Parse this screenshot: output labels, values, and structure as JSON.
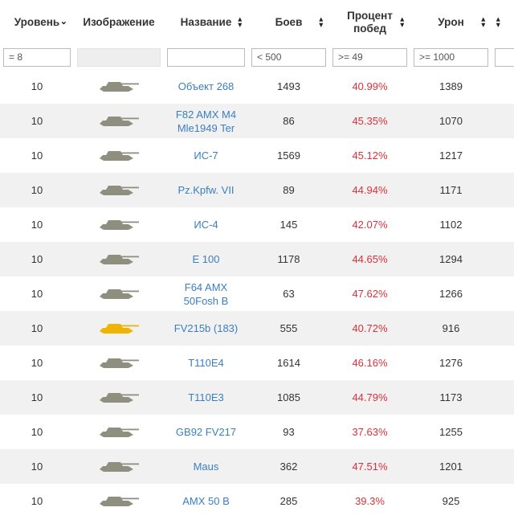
{
  "columns": [
    {
      "key": "level",
      "label": "Уровень",
      "sort": "desc"
    },
    {
      "key": "image",
      "label": "Изображение",
      "sort": "none"
    },
    {
      "key": "name",
      "label": "Название",
      "sort": "both"
    },
    {
      "key": "battles",
      "label": "Боев",
      "sort": "both"
    },
    {
      "key": "winrate",
      "label": "Процент побед",
      "sort": "both"
    },
    {
      "key": "damage",
      "label": "Урон",
      "sort": "both"
    },
    {
      "key": "extra",
      "label": "",
      "sort": "both"
    }
  ],
  "filters": {
    "level": "= 8",
    "name": "",
    "battles": "< 500",
    "winrate": ">= 49",
    "damage": ">= 1000",
    "extra": ""
  },
  "colors": {
    "winrate": "#d9313c",
    "link": "#3a7fc1",
    "tank_default": "#8f8f80",
    "tank_premium": "#f0b400"
  },
  "rows": [
    {
      "level": "10",
      "name": "Объект 268",
      "battles": "1493",
      "winrate": "40.99%",
      "damage": "1389",
      "icon": "tank-silhouette"
    },
    {
      "level": "10",
      "name": "F82 AMX M4 Mle1949 Ter",
      "battles": "86",
      "winrate": "45.35%",
      "damage": "1070",
      "icon": "tank-silhouette"
    },
    {
      "level": "10",
      "name": "ИС-7",
      "battles": "1569",
      "winrate": "45.12%",
      "damage": "1217",
      "icon": "tank-silhouette"
    },
    {
      "level": "10",
      "name": "Pz.Kpfw. VII",
      "battles": "89",
      "winrate": "44.94%",
      "damage": "1171",
      "icon": "tank-silhouette"
    },
    {
      "level": "10",
      "name": "ИС-4",
      "battles": "145",
      "winrate": "42.07%",
      "damage": "1102",
      "icon": "tank-silhouette"
    },
    {
      "level": "10",
      "name": "E 100",
      "battles": "1178",
      "winrate": "44.65%",
      "damage": "1294",
      "icon": "tank-silhouette"
    },
    {
      "level": "10",
      "name": "F64 AMX 50Fosh B",
      "battles": "63",
      "winrate": "47.62%",
      "damage": "1266",
      "icon": "tank-silhouette"
    },
    {
      "level": "10",
      "name": "FV215b (183)",
      "battles": "555",
      "winrate": "40.72%",
      "damage": "916",
      "icon": "tank-silhouette-premium"
    },
    {
      "level": "10",
      "name": "T110E4",
      "battles": "1614",
      "winrate": "46.16%",
      "damage": "1276",
      "icon": "tank-silhouette"
    },
    {
      "level": "10",
      "name": "T110E3",
      "battles": "1085",
      "winrate": "44.79%",
      "damage": "1173",
      "icon": "tank-silhouette"
    },
    {
      "level": "10",
      "name": "GB92 FV217",
      "battles": "93",
      "winrate": "37.63%",
      "damage": "1255",
      "icon": "tank-silhouette"
    },
    {
      "level": "10",
      "name": "Maus",
      "battles": "362",
      "winrate": "47.51%",
      "damage": "1201",
      "icon": "tank-silhouette"
    },
    {
      "level": "10",
      "name": "AMX 50 B",
      "battles": "285",
      "winrate": "39.3%",
      "damage": "925",
      "icon": "tank-silhouette"
    }
  ]
}
